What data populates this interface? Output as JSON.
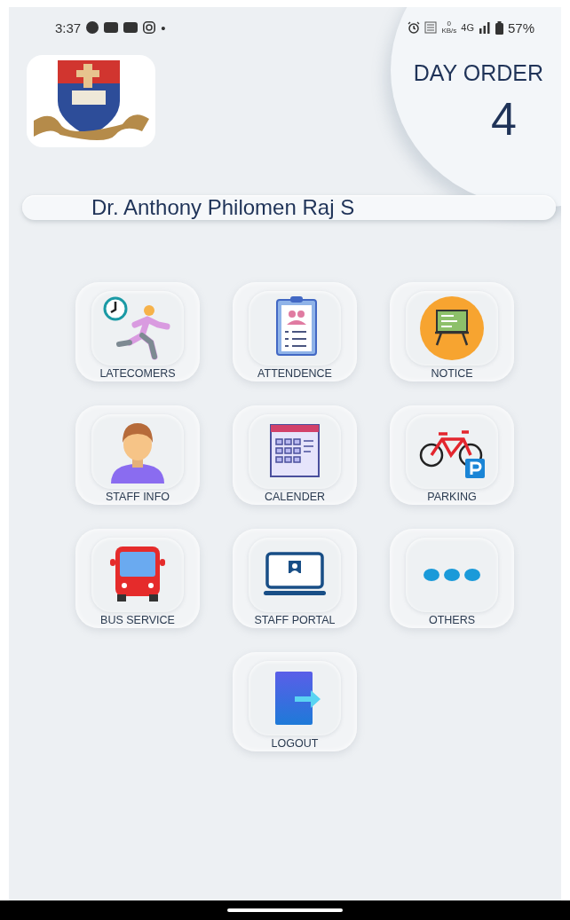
{
  "status_bar": {
    "time": "3:37",
    "notification_dot": "•",
    "speed_value": "0",
    "speed_unit": "KB/s",
    "network": "4G",
    "battery": "57%"
  },
  "header": {
    "day_order_label": "DAY ORDER",
    "day_order_value": "4",
    "user_name": "Dr. Anthony Philomen Raj S"
  },
  "tiles": [
    {
      "label": "LATECOMERS",
      "kind": "latecomers"
    },
    {
      "label": "ATTENDENCE",
      "kind": "attendance"
    },
    {
      "label": "NOTICE",
      "kind": "notice"
    },
    {
      "label": "STAFF INFO",
      "kind": "staff"
    },
    {
      "label": "CALENDER",
      "kind": "calendar"
    },
    {
      "label": "PARKING",
      "kind": "parking"
    },
    {
      "label": "BUS SERVICE",
      "kind": "bus"
    },
    {
      "label": "STAFF PORTAL",
      "kind": "portal"
    },
    {
      "label": "OTHERS",
      "kind": "others"
    },
    {
      "label": "LOGOUT",
      "kind": "logout"
    }
  ]
}
